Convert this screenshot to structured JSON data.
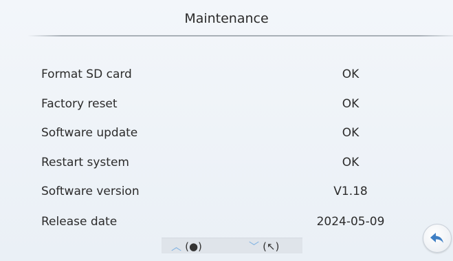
{
  "header": {
    "title": "Maintenance"
  },
  "rows": [
    {
      "label": "Format SD card",
      "value": "OK"
    },
    {
      "label": "Factory reset",
      "value": "OK"
    },
    {
      "label": "Software update",
      "value": "OK"
    },
    {
      "label": "Restart system",
      "value": "OK"
    },
    {
      "label": "Software version",
      "value": "V1.18"
    },
    {
      "label": "Release date",
      "value": "2024-05-09"
    }
  ],
  "nav_hint": {
    "up_arrow": "︿",
    "up_symbol": "(●)",
    "down_arrow": "﹀",
    "down_symbol": "(↖)"
  },
  "icons": {
    "back": "back-arrow-icon"
  },
  "colors": {
    "background": "#eef2f7",
    "accent": "#3f7fc4",
    "arrow": "#7fb2e2"
  }
}
